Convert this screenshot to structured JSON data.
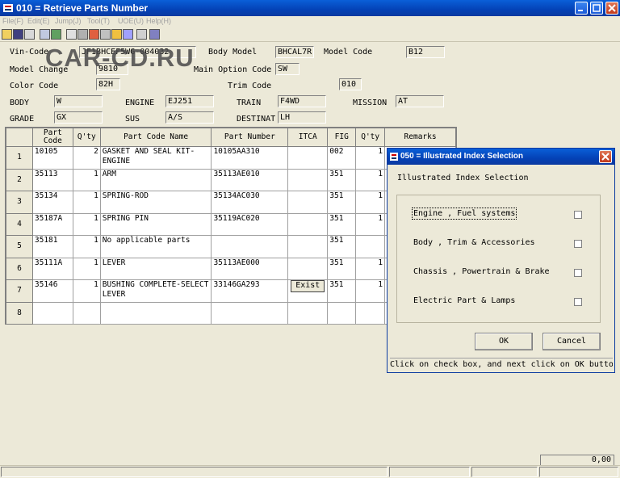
{
  "window": {
    "title": "010 = Retrieve Parts Number"
  },
  "menu": [
    "File(F)",
    "Edit(E)",
    "Jump(J)",
    "Tool(T)",
    "UOE(U)",
    "Help(H)"
  ],
  "watermark": "CAR-CD.RU",
  "form": {
    "vin_code_label": "Vin-Code",
    "vin_code": "JF1BHCEF5WG-004032",
    "body_model_label": "Body Model",
    "body_model": "BHCAL7R",
    "model_code_label": "Model Code",
    "model_code": "B12",
    "model_change_label": "Model Change",
    "model_change": "9810",
    "main_option_code_label": "Main Option Code",
    "main_option_code": "SW",
    "color_code_label": "Color Code",
    "color_code": "82H",
    "trim_code_label": "Trim Code",
    "trim_code": "010",
    "body_label": "BODY",
    "body": "W",
    "engine_label": "ENGINE",
    "engine": "EJ251",
    "train_label": "TRAIN",
    "train": "F4WD",
    "mission_label": "MISSION",
    "mission": "AT",
    "grade_label": "GRADE",
    "grade": "GX",
    "sus_label": "SUS",
    "sus": "A/S",
    "destinat_label": "DESTINAT",
    "destinat": "LH"
  },
  "table": {
    "headers": [
      "Part Code",
      "Q'ty",
      "Part Code Name",
      "Part Number",
      "ITCA",
      "FIG",
      "Q'ty",
      "Remarks"
    ],
    "rows": [
      {
        "n": "1",
        "code": "10105",
        "qty": "2",
        "name": "GASKET AND SEAL KIT-ENGINE",
        "pn": "10105AA310",
        "itca": "",
        "fig": "002",
        "qty2": "1"
      },
      {
        "n": "2",
        "code": "35113",
        "qty": "1",
        "name": "ARM",
        "pn": "35113AE010",
        "itca": "",
        "fig": "351",
        "qty2": "1"
      },
      {
        "n": "3",
        "code": "35134",
        "qty": "1",
        "name": "SPRING-ROD",
        "pn": "35134AC030",
        "itca": "",
        "fig": "351",
        "qty2": "1"
      },
      {
        "n": "4",
        "code": "35187A",
        "qty": "1",
        "name": "SPRING PIN",
        "pn": "35119AC020",
        "itca": "",
        "fig": "351",
        "qty2": "1"
      },
      {
        "n": "5",
        "code": "35181",
        "qty": "1",
        "name": "No applicable parts",
        "pn": "",
        "itca": "",
        "fig": "351",
        "qty2": ""
      },
      {
        "n": "6",
        "code": "35111A",
        "qty": "1",
        "name": "LEVER",
        "pn": "35113AE000",
        "itca": "",
        "fig": "351",
        "qty2": "1"
      },
      {
        "n": "7",
        "code": "35146",
        "qty": "1",
        "name": "BUSHING COMPLETE-SELECT LEVER",
        "pn": "33146GA293",
        "itca": "Exist",
        "fig": "351",
        "qty2": "1"
      },
      {
        "n": "8",
        "code": "",
        "qty": "",
        "name": "",
        "pn": "",
        "itca": "",
        "fig": "",
        "qty2": ""
      }
    ]
  },
  "dialog": {
    "title": "050 = Illustrated Index Selection",
    "heading": "Illustrated Index Selection",
    "options": [
      "Engine , Fuel systems",
      "Body , Trim & Accessories",
      "Chassis , Powertrain & Brake",
      "Electric Part & Lamps"
    ],
    "ok_label": "OK",
    "cancel_label": "Cancel",
    "status": "Click on check box, and next click on OK button"
  },
  "statusbar": {
    "value": "0,00"
  }
}
